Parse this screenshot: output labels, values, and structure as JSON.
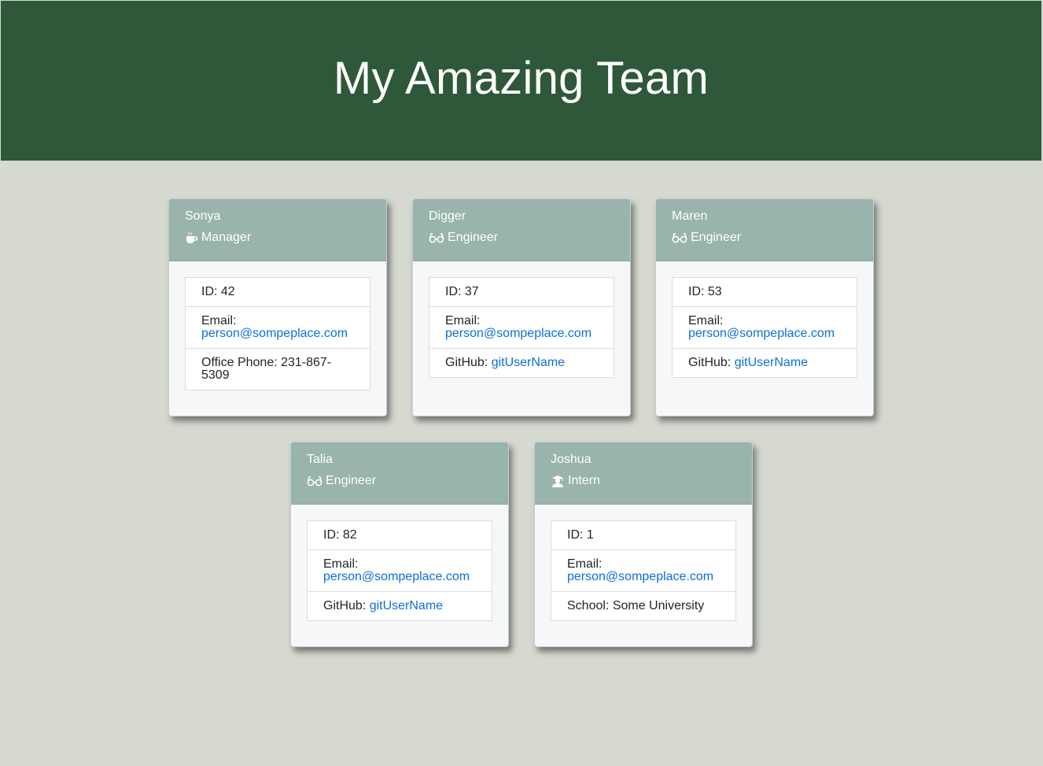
{
  "header": {
    "title": "My Amazing Team"
  },
  "colors": {
    "header_bg": "#2e5839",
    "page_bg": "#d5d9d0",
    "card_head_bg": "#98b4ad",
    "link": "#0b6fdc"
  },
  "team": [
    {
      "name": "Sonya",
      "role": "Manager",
      "icon": "coffee-mug-icon",
      "id_label": "ID: 42",
      "email_label": "Email:",
      "email": "person@sompeplace.com",
      "extra_label": "Office Phone: 231-867-",
      "extra_value": "5309"
    },
    {
      "name": "Digger",
      "role": "Engineer",
      "icon": "glasses-icon",
      "id_label": "ID: 37",
      "email_label": "Email:",
      "email": "person@sompeplace.com",
      "extra_label": "GitHub: ",
      "extra_value": "gitUserName"
    },
    {
      "name": "Maren",
      "role": "Engineer",
      "icon": "glasses-icon",
      "id_label": "ID: 53",
      "email_label": "Email:",
      "email": "person@sompeplace.com",
      "extra_label": "GitHub: ",
      "extra_value": "gitUserName"
    },
    {
      "name": "Talia",
      "role": "Engineer",
      "icon": "glasses-icon",
      "id_label": "ID: 82",
      "email_label": "Email:",
      "email": "person@sompeplace.com",
      "extra_label": "GitHub: ",
      "extra_value": "gitUserName"
    },
    {
      "name": "Joshua",
      "role": "Intern",
      "icon": "graduate-icon",
      "id_label": "ID: 1",
      "email_label": "Email:",
      "email": "person@sompeplace.com",
      "extra_label": "School: Some University",
      "extra_value": ""
    }
  ]
}
